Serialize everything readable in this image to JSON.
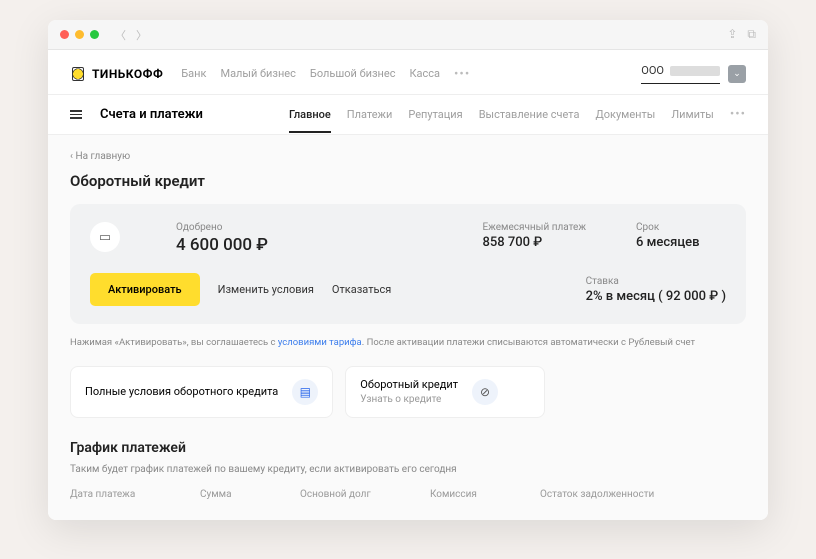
{
  "brand": "ТИНЬКОФФ",
  "topnav": {
    "bank": "Банк",
    "small": "Малый бизнес",
    "big": "Большой бизнес",
    "kassa": "Касса"
  },
  "org": {
    "prefix": "ООО"
  },
  "subtitle": "Счета и платежи",
  "tabs": {
    "main": "Главное",
    "payments": "Платежи",
    "reputation": "Репутация",
    "invoice": "Выставление счета",
    "docs": "Документы",
    "limits": "Лимиты"
  },
  "back": "‹ На главную",
  "page_title": "Оборотный кредит",
  "card": {
    "approved_label": "Одобрено",
    "approved_value": "4 600 000 ₽",
    "monthly_label": "Ежемесячный платеж",
    "monthly_value": "858 700 ₽",
    "term_label": "Срок",
    "term_value": "6 месяцев",
    "activate": "Активировать",
    "change": "Изменить условия",
    "decline": "Отказаться",
    "rate_label": "Ставка",
    "rate_value": "2% в месяц ( 92 000 ₽ )"
  },
  "disclaimer": {
    "pre": "Нажимая «Активировать», вы соглашаетесь с ",
    "link": "условиями тарифа",
    "post": ". После активации платежи списываются автоматически с Рублевый счет"
  },
  "links": {
    "terms_title": "Полные условия оборотного кредита",
    "credit_title": "Оборотный кредит",
    "credit_sub": "Узнать о кредите"
  },
  "schedule": {
    "title": "График платежей",
    "note": "Таким будет график платежей по вашему кредиту, если активировать его сегодня",
    "cols": {
      "date": "Дата платежа",
      "sum": "Сумма",
      "principal": "Основной долг",
      "fee": "Комиссия",
      "balance": "Остаток задолженности"
    }
  }
}
